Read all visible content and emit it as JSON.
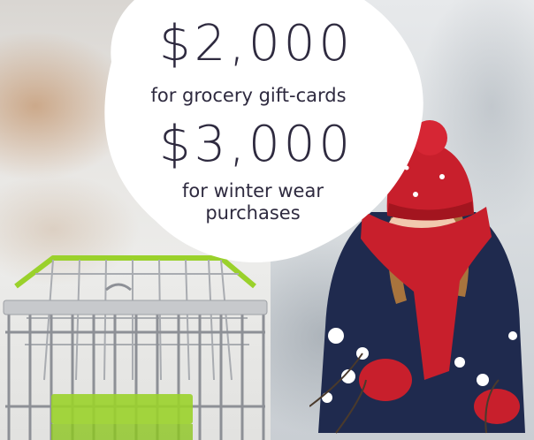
{
  "offer": {
    "grocery_amount": "$2,000",
    "grocery_label": "for grocery gift-cards",
    "winter_amount": "$3,000",
    "winter_label": "for winter wear purchases"
  },
  "images": {
    "left_photo": "shopping-cart-photo",
    "right_photo": "child-in-snow-photo"
  },
  "colors": {
    "text": "#2e2a3f",
    "bubble": "#ffffff",
    "cart_accent": "#9ad12b",
    "hat_red": "#c81f2c",
    "coat_navy": "#1f2a4e"
  }
}
